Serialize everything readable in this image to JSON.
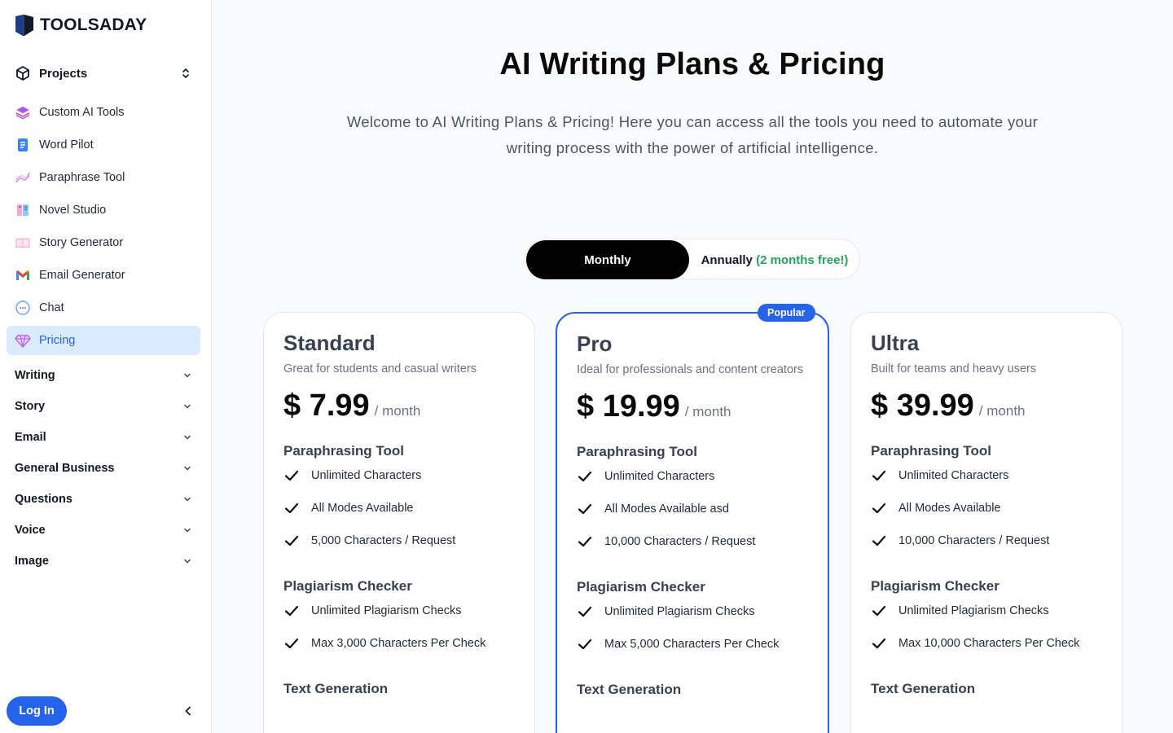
{
  "brand": {
    "name": "TOOLSADAY"
  },
  "sidebar": {
    "projects_label": "Projects",
    "items": [
      {
        "label": "Custom AI Tools",
        "icon": "layers-icon"
      },
      {
        "label": "Word Pilot",
        "icon": "document-icon"
      },
      {
        "label": "Paraphrase Tool",
        "icon": "paraphrase-icon"
      },
      {
        "label": "Novel Studio",
        "icon": "book-icon"
      },
      {
        "label": "Story Generator",
        "icon": "story-icon"
      },
      {
        "label": "Email Generator",
        "icon": "gmail-icon"
      },
      {
        "label": "Chat",
        "icon": "chat-bubble-icon"
      },
      {
        "label": "Pricing",
        "icon": "diamond-icon",
        "active": true
      }
    ],
    "groups": [
      "Writing",
      "Story",
      "Email",
      "General Business",
      "Questions",
      "Voice",
      "Image"
    ],
    "login_label": "Log In"
  },
  "main": {
    "title": "AI Writing Plans & Pricing",
    "intro": "Welcome to AI Writing Plans & Pricing! Here you can access all the tools you need to automate your writing process with the power of artificial intelligence.",
    "billing_toggle": {
      "monthly": "Monthly",
      "annually": "Annually",
      "annually_note": "(2 months free!)",
      "selected": "Monthly"
    },
    "plans": [
      {
        "name": "Standard",
        "subtitle": "Great for students and casual writers",
        "price": "$ 7.99",
        "period": "/ month",
        "sections": [
          {
            "title": "Paraphrasing Tool",
            "features": [
              "Unlimited Characters",
              "All Modes Available",
              "5,000 Characters / Request"
            ]
          },
          {
            "title": "Plagiarism Checker",
            "features": [
              "Unlimited Plagiarism Checks",
              "Max 3,000 Characters Per Check"
            ]
          },
          {
            "title": "Text Generation",
            "features": []
          }
        ]
      },
      {
        "name": "Pro",
        "badge": "Popular",
        "subtitle": "Ideal for professionals and content creators",
        "price": "$ 19.99",
        "period": "/ month",
        "sections": [
          {
            "title": "Paraphrasing Tool",
            "features": [
              "Unlimited Characters",
              "All Modes Available asd",
              "10,000 Characters / Request"
            ]
          },
          {
            "title": "Plagiarism Checker",
            "features": [
              "Unlimited Plagiarism Checks",
              "Max 5,000 Characters Per Check"
            ]
          },
          {
            "title": "Text Generation",
            "features": []
          }
        ]
      },
      {
        "name": "Ultra",
        "subtitle": "Built for teams and heavy users",
        "price": "$ 39.99",
        "period": "/ month",
        "sections": [
          {
            "title": "Paraphrasing Tool",
            "features": [
              "Unlimited Characters",
              "All Modes Available",
              "10,000 Characters / Request"
            ]
          },
          {
            "title": "Plagiarism Checker",
            "features": [
              "Unlimited Plagiarism Checks",
              "Max 10,000 Characters Per Check"
            ]
          },
          {
            "title": "Text Generation",
            "features": []
          }
        ]
      }
    ]
  },
  "colors": {
    "accent": "#2563eb",
    "active_bg": "#dbeafe",
    "free_note": "#22a45d",
    "toggle_active": "#000000"
  }
}
